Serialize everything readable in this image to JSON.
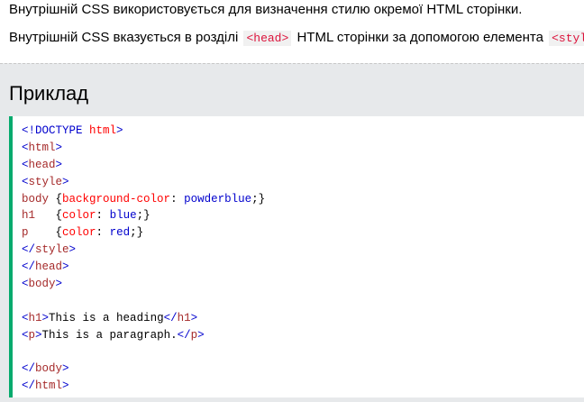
{
  "intro": {
    "p1": "Внутрішній CSS використовується для визначення стилю окремої HTML сторінки.",
    "p2_before": "Внутрішній CSS вказується в розділі",
    "p2_code1": "<head>",
    "p2_middle": "HTML сторінки за допомогою елемента",
    "p2_code2": "<style>",
    "p2_end": ":"
  },
  "example": {
    "title": "Приклад",
    "code": {
      "doctype_open": "<!DOCTYPE",
      "doctype_attr": " html",
      "doctype_close": ">",
      "lt": "<",
      "gt": ">",
      "lt_slash": "</",
      "html": "html",
      "head": "head",
      "style": "style",
      "body": "body",
      "h1": "h1",
      "p": "p",
      "sel_body": "body ",
      "sel_h1": "h1   ",
      "sel_p": "p    ",
      "brace_open": "{",
      "brace_close": "}",
      "prop_bg": "background-color",
      "prop_color": "color",
      "colon": ": ",
      "semicolon": ";",
      "val_bg": "powderblue",
      "val_blue": "blue",
      "val_red": "red",
      "heading_text": "This is a heading",
      "paragraph_text": "This is a paragraph."
    }
  }
}
